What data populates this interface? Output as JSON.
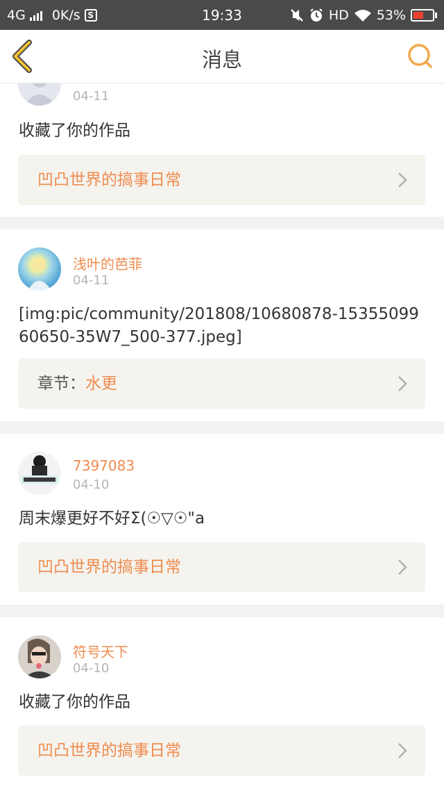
{
  "status_bar": {
    "network": "4G",
    "speed": "0K/s",
    "s_icon_label": "S",
    "time": "19:33",
    "hd": "HD",
    "battery": "53%",
    "battery_level": 0.53,
    "icons": [
      "signal-icon",
      "s-app-icon",
      "mute-icon",
      "alarm-icon",
      "wifi-icon",
      "battery-icon"
    ]
  },
  "header": {
    "title": "消息",
    "back_icon": "chevron-left-icon",
    "search_icon": "search-icon",
    "accent_color": "#f0a84a"
  },
  "messages": [
    {
      "date": "04-11",
      "content": "收藏了你的作品",
      "link_prefix": "",
      "link_title": "凹凸世界的搞事日常"
    },
    {
      "user": "浅叶的芭菲",
      "date": "04-11",
      "content": "[img:pic/community/201808/10680878-1535509960650-35W7_500-377.jpeg]",
      "link_prefix": "章节：",
      "link_title": "水更"
    },
    {
      "user": "7397083",
      "date": "04-10",
      "content": "周末爆更好不好Σ(☉▽☉\"a",
      "link_prefix": "",
      "link_title": "凹凸世界的搞事日常"
    },
    {
      "user": "符号天下",
      "date": "04-10",
      "content": "收藏了你的作品",
      "link_prefix": "",
      "link_title": "凹凸世界的搞事日常"
    }
  ],
  "colors": {
    "username": "#f08b4e",
    "date": "#b5b5b5",
    "link_bg": "#f4f3ee",
    "status_bar_bg": "#4a4a4a"
  }
}
